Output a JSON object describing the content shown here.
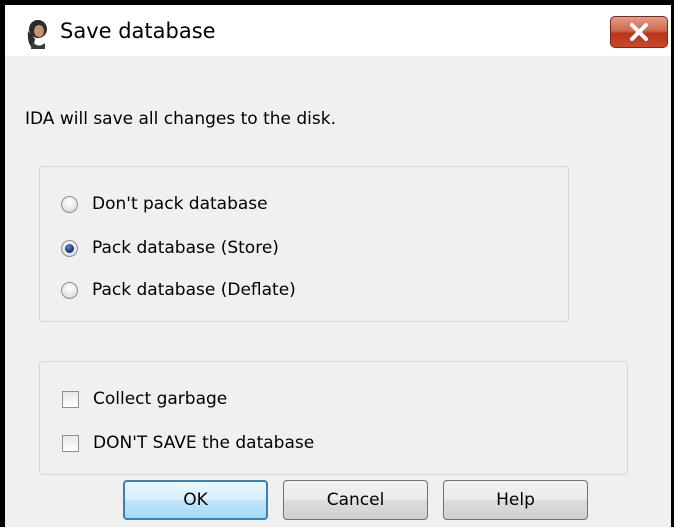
{
  "window": {
    "title": "Save database",
    "close_icon": "close-icon",
    "app_icon": "ida-app-icon"
  },
  "message": "IDA will save all changes to the disk.",
  "pack_options": [
    {
      "label": "Don't pack database",
      "selected": false
    },
    {
      "label": "Pack database (Store)",
      "selected": true
    },
    {
      "label": "Pack database (Deflate)",
      "selected": false
    }
  ],
  "checkboxes": [
    {
      "label": "Collect garbage",
      "checked": false
    },
    {
      "label": "DON'T SAVE the database",
      "checked": false
    }
  ],
  "buttons": {
    "ok": "OK",
    "cancel": "Cancel",
    "help": "Help"
  },
  "colors": {
    "close_button": "#c54a2c",
    "default_button_border": "#3c7fb1",
    "dialog_background": "#f0f0f0"
  }
}
